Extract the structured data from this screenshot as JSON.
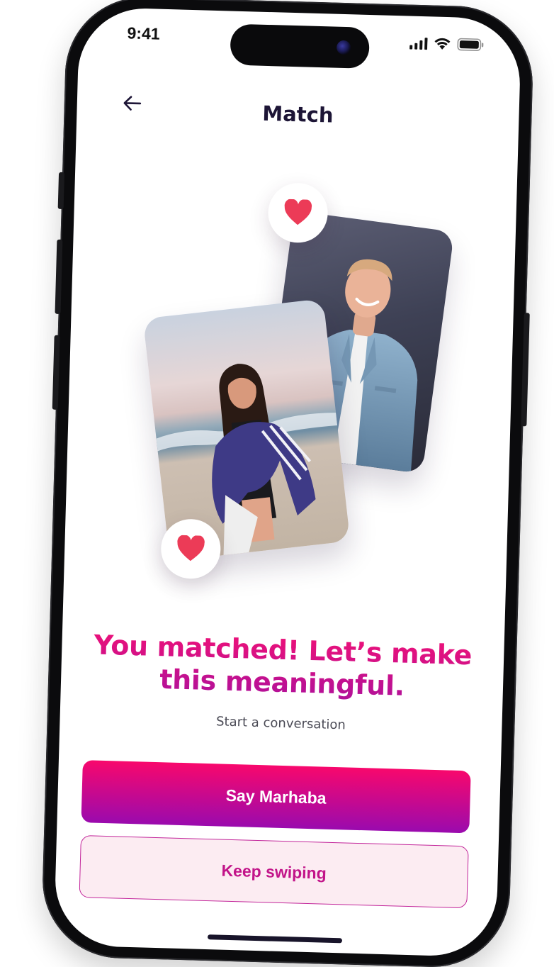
{
  "status_bar": {
    "time": "9:41"
  },
  "nav": {
    "title": "Match",
    "back_icon": "arrow-left-icon"
  },
  "match": {
    "headline": "You matched! Let’s make this meaningful.",
    "subtitle": "Start a conversation",
    "heart_icon": "heart-icon"
  },
  "actions": {
    "primary_label": "Say Marhaba",
    "secondary_label": "Keep swiping"
  },
  "colors": {
    "brand_pink": "#f8086c",
    "brand_purple": "#9a0aae",
    "heart_red": "#ec3b57",
    "title_dark": "#1d1536"
  }
}
